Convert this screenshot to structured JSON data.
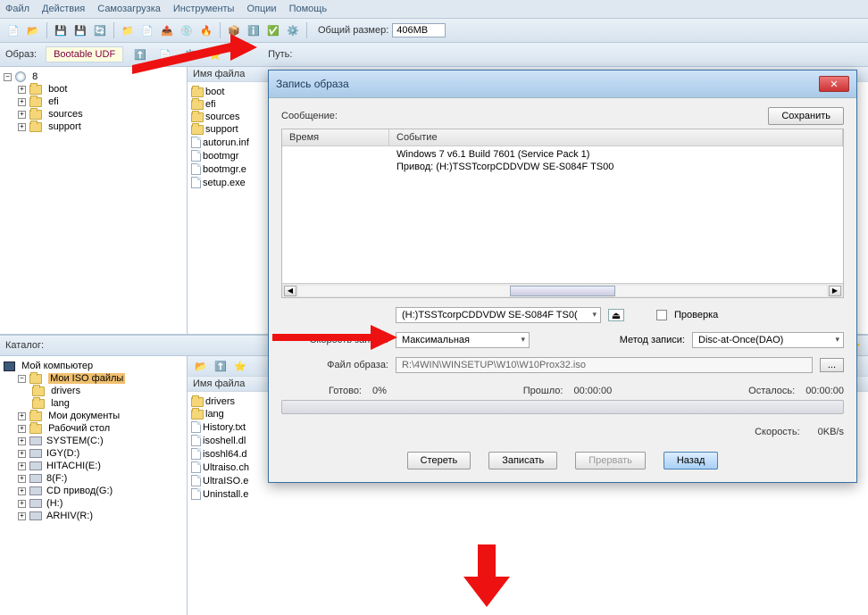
{
  "menu": {
    "file": "Файл",
    "actions": "Действия",
    "boot": "Самозагрузка",
    "tools": "Инструменты",
    "options": "Опции",
    "help": "Помощь"
  },
  "toolbar": {
    "total_size_label": "Общий размер:",
    "total_size_value": "406MB"
  },
  "row2": {
    "image_label": "Образ:",
    "bootable": "Bootable UDF",
    "path_label": "Путь:"
  },
  "left_tree": {
    "root": "8",
    "items": [
      "boot",
      "efi",
      "sources",
      "support"
    ]
  },
  "mid": {
    "header": "Имя файла",
    "items": [
      {
        "name": "boot",
        "type": "folder"
      },
      {
        "name": "efi",
        "type": "folder"
      },
      {
        "name": "sources",
        "type": "folder"
      },
      {
        "name": "support",
        "type": "folder"
      },
      {
        "name": "autorun.inf",
        "type": "file"
      },
      {
        "name": "bootmgr",
        "type": "file"
      },
      {
        "name": "bootmgr.e",
        "type": "file"
      },
      {
        "name": "setup.exe",
        "type": "file"
      }
    ]
  },
  "catalog": {
    "label": "Каталог:",
    "root": "Мой компьютер",
    "iso": "Мои ISO файлы",
    "drivers": "drivers",
    "lang": "lang",
    "docs": "Мои документы",
    "desktop": "Рабочий стол",
    "drives": [
      "SYSTEM(C:)",
      "IGY(D:)",
      "HITACHI(E:)",
      "8(F:)",
      "CD привод(G:)",
      "(H:)",
      "ARHIV(R:)"
    ]
  },
  "bottom_right": {
    "header": "Имя файла",
    "items": [
      {
        "name": "drivers",
        "type": "folder"
      },
      {
        "name": "lang",
        "type": "folder"
      },
      {
        "name": "History.txt",
        "type": "file"
      },
      {
        "name": "isoshell.dl",
        "type": "file"
      },
      {
        "name": "isoshl64.d",
        "type": "file"
      },
      {
        "name": "Ultraiso.ch",
        "type": "file"
      },
      {
        "name": "UltraISO.e",
        "type": "file"
      },
      {
        "name": "Uninstall.e",
        "type": "file"
      }
    ]
  },
  "dialog": {
    "title": "Запись образа",
    "save": "Сохранить",
    "msg_label": "Сообщение:",
    "col_time": "Время",
    "col_event": "Событие",
    "events": [
      {
        "t": "",
        "e": "Windows 7 v6.1 Build 7601 (Service Pack 1)"
      },
      {
        "t": "",
        "e": "Привод: (H:)TSSTcorpCDDVDW SE-S084F TS00"
      }
    ],
    "drive_label": "",
    "drive_value": "(H:)TSSTcorpCDDVDW SE-S084F TS0(",
    "verify": "Проверка",
    "speed_label": "Скорость записи:",
    "speed_value": "Максимальная",
    "method_label": "Метод записи:",
    "method_value": "Disc-at-Once(DAO)",
    "file_label": "Файл образа:",
    "file_value": "R:\\4WIN\\WINSETUP\\W10\\W10Prox32.iso",
    "ready": "Готово:",
    "pct": "0%",
    "elapsed_label": "Прошло:",
    "elapsed": "00:00:00",
    "remain_label": "Осталось:",
    "remain": "00:00:00",
    "speed2_label": "Скорость:",
    "speed2": "0KB/s",
    "erase": "Стереть",
    "burn": "Записать",
    "abort": "Прервать",
    "back": "Назад"
  }
}
